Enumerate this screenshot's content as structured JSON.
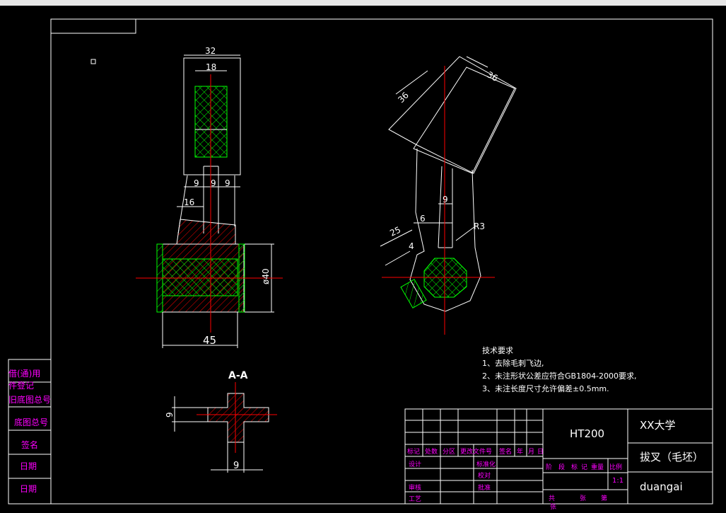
{
  "dims": {
    "d32": "32",
    "d18": "18",
    "d9a": "9",
    "d9b": "9",
    "d9c": "9",
    "d16": "16",
    "d40": "ø40",
    "d45": "45",
    "d36a": "36",
    "d36b": "36",
    "d6": "6",
    "d9r": "9",
    "d25": "25",
    "d4": "4",
    "r3": "R3",
    "section_title": "A-A",
    "sec_9v": "9",
    "sec_9h": "9"
  },
  "notes": {
    "title": "技术要求",
    "line1": "1、去除毛刺飞边,",
    "line2": "2、未注形状公差应符合GB1804-2000要求,",
    "line3": "3、未注长度尺寸允许偏差±0.5mm."
  },
  "sidebar": {
    "s1": "借(通)用",
    "s2": "件登记",
    "s3": "旧底图总号",
    "s4": "底图总号",
    "s5": "签名",
    "s6": "日期",
    "s7": "日期"
  },
  "titleblock": {
    "material": "HT200",
    "school": "XX大学",
    "part_name": "拔叉（毛坯）",
    "drawer": "duangai",
    "scale": "1:1",
    "h_mark": "标记",
    "h_count": "处数",
    "h_zone": "分区",
    "h_doc": "更改文件号",
    "h_sign": "签名",
    "h_year": "年",
    "h_month": "月",
    "h_day": "日",
    "r_design": "设计",
    "r_standard": "标准化",
    "r_proof": "校对",
    "r_review": "审核",
    "r_process": "工艺",
    "r_approve": "批准",
    "c_stage": "阶",
    "c_mark": "段",
    "c_mk2": "标",
    "c_mk3": "记",
    "c_weight": "重量",
    "c_ratio": "比例",
    "total": "共",
    "sheet": "张",
    "page": "第",
    "page2": "张"
  },
  "colors": {
    "outline": "#ffffff",
    "center": "#ff0000",
    "hatch_green": "#00ff00",
    "hatch_red": "#ff0000",
    "tb_text": "#ff00ff"
  }
}
